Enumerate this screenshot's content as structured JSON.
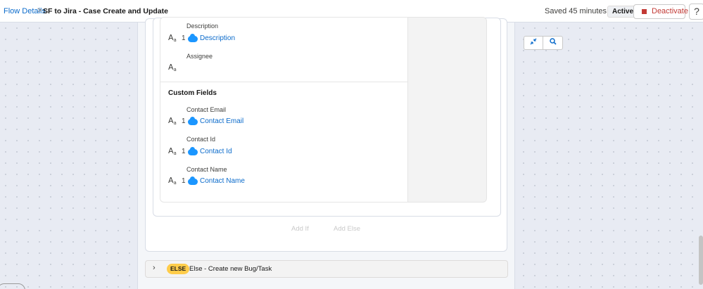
{
  "header": {
    "breadcrumb_link": "Flow Details",
    "breadcrumb_separator": ">",
    "flow_title": "SF to Jira - Case Create and Update",
    "saved_status": "Saved 45 minutes ago",
    "status_badge": "Active",
    "deactivate_label": "Deactivate",
    "help_label": "?"
  },
  "fields": {
    "description": {
      "label": "Description",
      "count": "1",
      "value": "Description",
      "icon": "text-icon"
    },
    "assignee": {
      "label": "Assignee",
      "icon": "text-icon"
    }
  },
  "custom_fields": {
    "title": "Custom Fields",
    "items": [
      {
        "label": "Contact Email",
        "count": "1",
        "value": "Contact Email"
      },
      {
        "label": "Contact Id",
        "count": "1",
        "value": "Contact Id"
      },
      {
        "label": "Contact Name",
        "count": "1",
        "value": "Contact Name"
      }
    ]
  },
  "actions": {
    "add_if": "Add If",
    "add_else": "Add Else"
  },
  "else_branch": {
    "badge": "ELSE",
    "label": "Else - Create new Bug/Task"
  },
  "toolbar": {
    "fit_icon": "collapse-arrows-icon",
    "search_icon": "search-icon"
  },
  "colors": {
    "link": "#0b6bcb",
    "danger": "#c23934",
    "else_badge": "#ffcc4a",
    "salesforce_cloud": "#1b96ff"
  }
}
